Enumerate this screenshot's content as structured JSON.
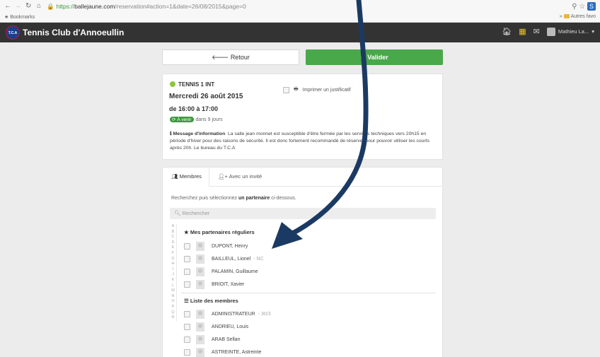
{
  "browser": {
    "url_scheme": "https://",
    "url_host": "ballejaune.com",
    "url_path": "/reservation#action=1&date=26/08/2015&page=0",
    "bookmarks_label": "Bookmarks",
    "other_bookmarks": "Autres favo"
  },
  "header": {
    "logo_text": "T.C.A",
    "club_name": "Tennis Club d'Annoeullin",
    "user_name": "Mathieu La..."
  },
  "actions": {
    "back_label": "Retour",
    "validate_label": "Valider"
  },
  "reservation": {
    "court": "TENNIS 1 INT",
    "date": "Mercredi 26 août 2015",
    "time": "de 16:00 à 17:00",
    "status_badge": "À venir",
    "days_left": "dans 9 jours",
    "print_label": "Imprimer un justificatif",
    "info_title": "Message d'information",
    "info_text": "La salle jean monnet est susceptible d'être fermée par les services techniques vers 20h15 en période d'hiver pour des raisons de sécurité. Il est donc fortement recommandé de réserver pour pouvoir utiliser les courts après 20h. Le bureau du T.C.A"
  },
  "partners": {
    "tab_members": "Membres",
    "tab_guest": "Avec un invité",
    "hint_before": "Recherchez puis sélectionnez ",
    "hint_bold": "un partenaire",
    "hint_after": " ci-dessous.",
    "search_placeholder": "Rechercher",
    "alphabet": [
      "A",
      "B",
      "C",
      "D",
      "E",
      "F",
      "G",
      "H",
      "I",
      "J",
      "K",
      "L",
      "M",
      "N",
      "O",
      "P",
      "Q",
      "R"
    ],
    "regular_title": "Mes partenaires réguliers",
    "regular": [
      {
        "name": "DUPONT, Henry",
        "extra": ""
      },
      {
        "name": "BAILLEUL, Lionel",
        "extra": "- NC"
      },
      {
        "name": "PALAMIN, Guillaume",
        "extra": ""
      },
      {
        "name": "BRIOIT, Xavier",
        "extra": ""
      }
    ],
    "members_title": "Liste des membres",
    "members": [
      {
        "name": "ADMINISTRATEUR",
        "extra": "- 30/3"
      },
      {
        "name": "ANDRIEU, Louis",
        "extra": ""
      },
      {
        "name": "ARAB Sellan",
        "extra": ""
      },
      {
        "name": "ASTREINTE, Astreinte",
        "extra": ""
      }
    ]
  },
  "colors": {
    "appbar": "#333333",
    "accent_green": "#49a84a",
    "arrow": "#1b3a63"
  }
}
